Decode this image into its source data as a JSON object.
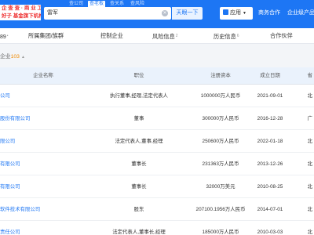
{
  "header": {
    "logo_line1": "企 查 查 · 商 业 工 具",
    "logo_line2": "好子 基金旗下机构",
    "search_tabs": [
      "查公司",
      "查老板",
      "查关系",
      "查风险"
    ],
    "active_tab_index": 1,
    "search_value": "雷军",
    "search_button": "天眼一下",
    "app_button": "应用",
    "nav_links": [
      "商务合作",
      "企业级产品"
    ]
  },
  "categories": [
    {
      "label": "任职",
      "count": "89",
      "partial": "89"
    },
    {
      "label": "所属集团/族群",
      "count": ""
    },
    {
      "label": "控制企业",
      "count": ""
    },
    {
      "label": "风险信息",
      "count": "2"
    },
    {
      "label": "历史信息",
      "count": "6"
    },
    {
      "label": "合作伙伴",
      "count": ""
    }
  ],
  "section": {
    "label": "企业",
    "count": "103"
  },
  "table": {
    "headers": [
      "企业名称",
      "职位",
      "注册资本",
      "成立日期",
      "省"
    ],
    "rows": [
      {
        "company": "公司",
        "position": "执行董事,经理,法定代表人",
        "capital": "1000000万人民币",
        "date": "2021-09-01",
        "last": "北"
      },
      {
        "company": "股份有限公司",
        "position": "董事",
        "capital": "300000万人民币",
        "date": "2016-12-28",
        "last": "广"
      },
      {
        "company": "限公司",
        "position": "法定代表人,董事,经理",
        "capital": "250600万人民币",
        "date": "2022-01-18",
        "last": "北"
      },
      {
        "company": "有限公司",
        "position": "董事长",
        "capital": "231363万人民币",
        "date": "2013-12-26",
        "last": "北"
      },
      {
        "company": "有限公司",
        "position": "董事长",
        "capital": "32000万美元",
        "date": "2010-08-25",
        "last": "北"
      },
      {
        "company": "软件技术有限公司",
        "position": "股东",
        "capital": "207100.1956万人民币",
        "date": "2014-07-01",
        "last": "北"
      },
      {
        "company": "责任公司",
        "position": "法定代表人,董事长,经理",
        "capital": "185000万人民币",
        "date": "2010-03-03",
        "last": "北"
      }
    ]
  }
}
